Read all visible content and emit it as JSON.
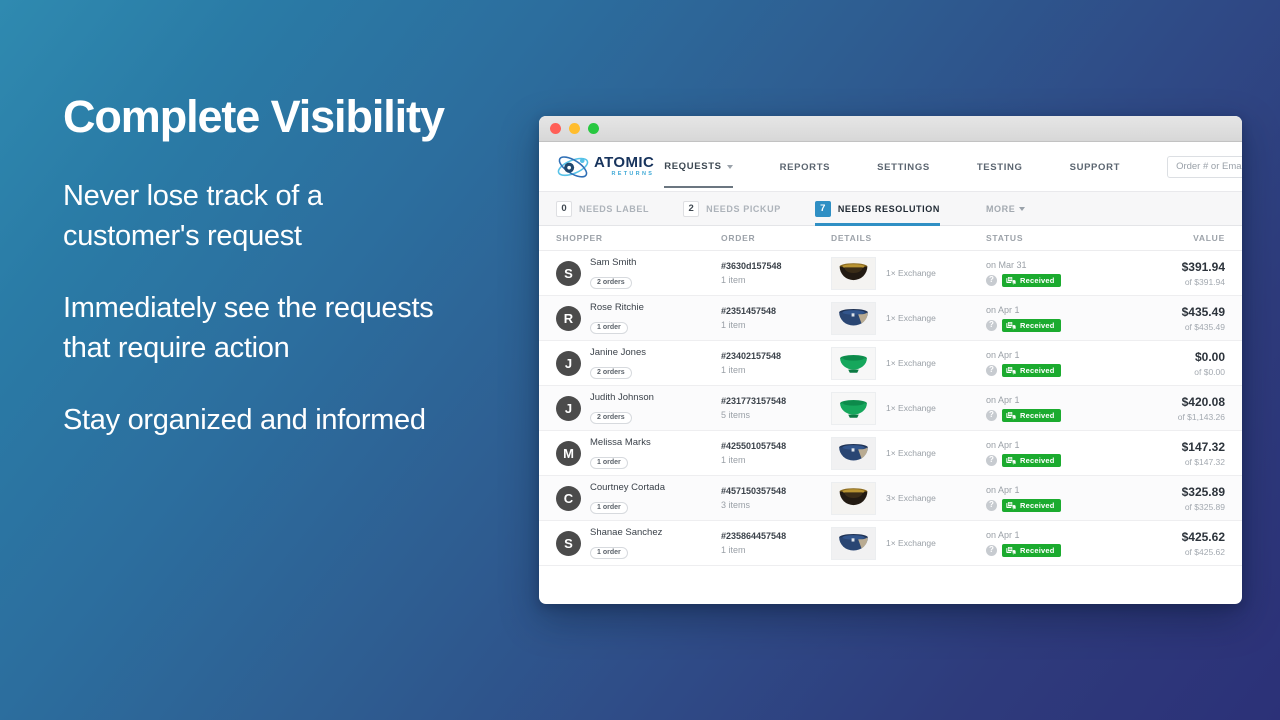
{
  "marketing": {
    "headline": "Complete Visibility",
    "bullets": [
      "Never lose track of a customer's request",
      "Immediately see the requests that require action",
      "Stay organized and informed"
    ]
  },
  "window": {
    "traffic_lights": [
      "close",
      "minimize",
      "zoom"
    ]
  },
  "brand": {
    "name": "ATOMIC",
    "tagline": "RETURNS"
  },
  "nav": {
    "links": [
      {
        "label": "REQUESTS",
        "has_caret": true,
        "active": true
      },
      {
        "label": "REPORTS",
        "has_caret": false,
        "active": false
      },
      {
        "label": "SETTINGS",
        "has_caret": false,
        "active": false
      },
      {
        "label": "TESTING",
        "has_caret": false,
        "active": false
      },
      {
        "label": "SUPPORT",
        "has_caret": false,
        "active": false
      }
    ],
    "search": {
      "value": "",
      "placeholder": "Order # or Email..."
    }
  },
  "tabs": [
    {
      "count": "0",
      "label": "NEEDS LABEL",
      "active": false
    },
    {
      "count": "2",
      "label": "NEEDS PICKUP",
      "active": false
    },
    {
      "count": "7",
      "label": "NEEDS RESOLUTION",
      "active": true
    }
  ],
  "tab_more_label": "MORE",
  "table": {
    "headers": {
      "shopper": "SHOPPER",
      "order": "ORDER",
      "details": "DETAILS",
      "status": "STATUS",
      "value": "VALUE"
    },
    "rows": [
      {
        "initial": "S",
        "name": "Sam Smith",
        "orders": "2 orders",
        "order_number": "#3630d157548",
        "items": "1 item",
        "thumb": "bowl-black-gold",
        "exchange": "1× Exchange",
        "status_date": "on Mar 31",
        "status_badge": "Received",
        "value": "$391.94",
        "value_of": "of $391.94"
      },
      {
        "initial": "R",
        "name": "Rose Ritchie",
        "orders": "1 order",
        "order_number": "#2351457548",
        "items": "1 item",
        "thumb": "bowl-blue-tan",
        "exchange": "1× Exchange",
        "status_date": "on Apr 1",
        "status_badge": "Received",
        "value": "$435.49",
        "value_of": "of $435.49"
      },
      {
        "initial": "J",
        "name": "Janine Jones",
        "orders": "2 orders",
        "order_number": "#23402157548",
        "items": "1 item",
        "thumb": "bowl-green",
        "exchange": "1× Exchange",
        "status_date": "on Apr 1",
        "status_badge": "Received",
        "value": "$0.00",
        "value_of": "of $0.00"
      },
      {
        "initial": "J",
        "name": "Judith Johnson",
        "orders": "2 orders",
        "order_number": "#231773157548",
        "items": "5 items",
        "thumb": "bowl-green",
        "exchange": "1× Exchange",
        "status_date": "on Apr 1",
        "status_badge": "Received",
        "value": "$420.08",
        "value_of": "of $1,143.26"
      },
      {
        "initial": "M",
        "name": "Melissa Marks",
        "orders": "1 order",
        "order_number": "#425501057548",
        "items": "1 item",
        "thumb": "bowl-blue-tan",
        "exchange": "1× Exchange",
        "status_date": "on Apr 1",
        "status_badge": "Received",
        "value": "$147.32",
        "value_of": "of $147.32"
      },
      {
        "initial": "C",
        "name": "Courtney Cortada",
        "orders": "1 order",
        "order_number": "#457150357548",
        "items": "3 items",
        "thumb": "bowl-black-gold",
        "exchange": "3× Exchange",
        "status_date": "on Apr 1",
        "status_badge": "Received",
        "value": "$325.89",
        "value_of": "of $325.89"
      },
      {
        "initial": "S",
        "name": "Shanae Sanchez",
        "orders": "1 order",
        "order_number": "#235864457548",
        "items": "1 item",
        "thumb": "bowl-blue-tan",
        "exchange": "1× Exchange",
        "status_date": "on Apr 1",
        "status_badge": "Received",
        "value": "$425.62",
        "value_of": "of $425.62"
      }
    ]
  },
  "colors": {
    "accent": "#2f8fc4",
    "badge_green": "#1bab2f",
    "brand_navy": "#17335c",
    "brand_cyan": "#3fa9d6",
    "bg_start": "#2f8ab0",
    "bg_end": "#2c3178"
  }
}
